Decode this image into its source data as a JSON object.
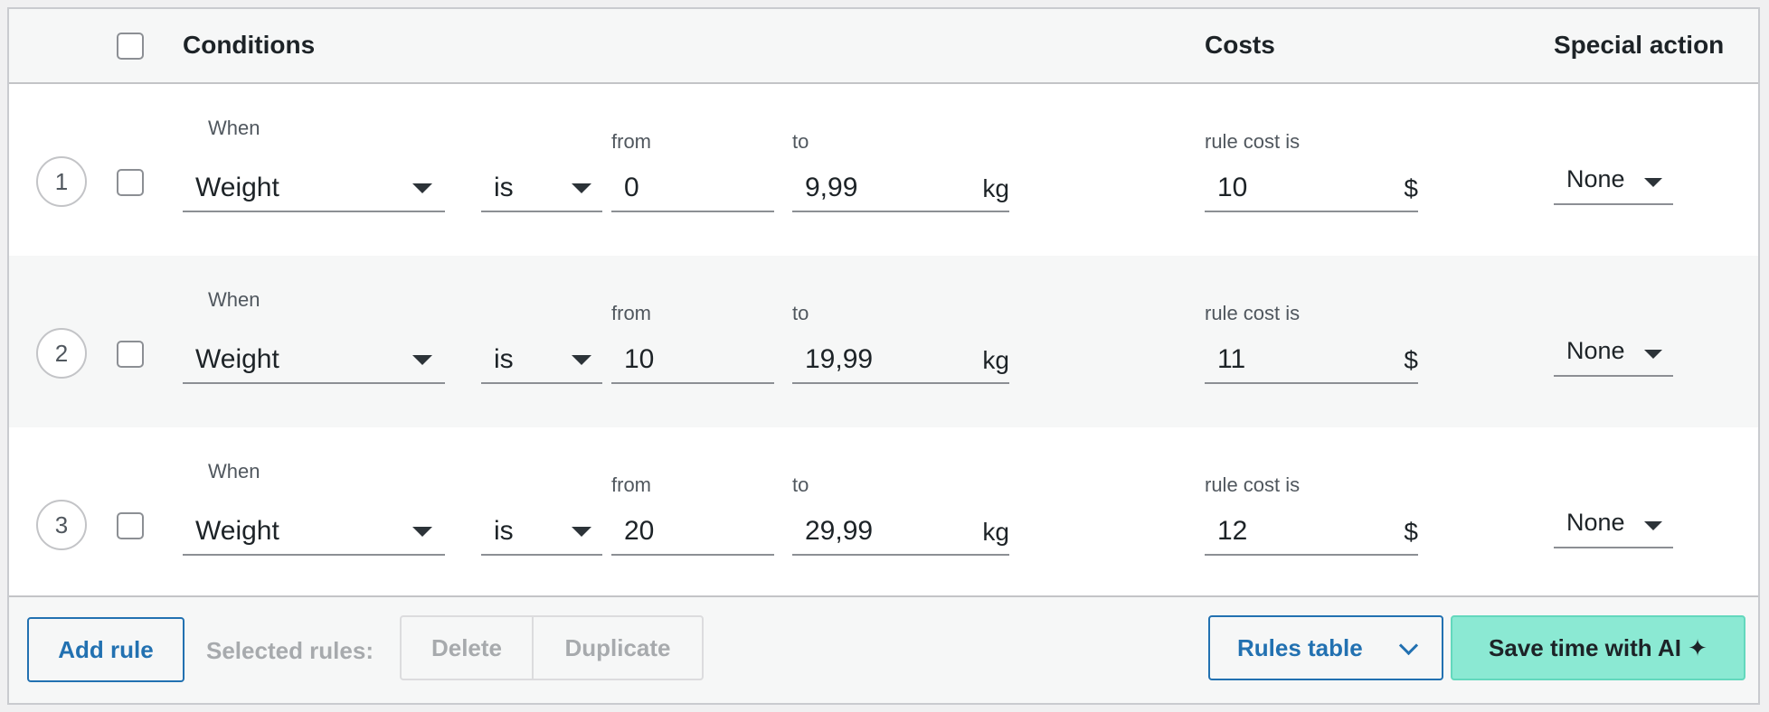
{
  "header": {
    "conditions": "Conditions",
    "costs": "Costs",
    "special_action": "Special action"
  },
  "labels": {
    "when": "When",
    "from": "from",
    "to": "to",
    "rule_cost": "rule cost is",
    "weight_unit": "kg",
    "currency": "$"
  },
  "rules": [
    {
      "number": "1",
      "condition": "Weight",
      "operator": "is",
      "from": "0",
      "to": "9,99",
      "cost": "10",
      "special": "None"
    },
    {
      "number": "2",
      "condition": "Weight",
      "operator": "is",
      "from": "10",
      "to": "19,99",
      "cost": "11",
      "special": "None"
    },
    {
      "number": "3",
      "condition": "Weight",
      "operator": "is",
      "from": "20",
      "to": "29,99",
      "cost": "12",
      "special": "None"
    }
  ],
  "footer": {
    "add_rule": "Add rule",
    "selected_rules": "Selected rules:",
    "delete": "Delete",
    "duplicate": "Duplicate",
    "rules_table": "Rules table",
    "save_ai": "Save time with AI ✦"
  },
  "colors": {
    "accent": "#2271b1",
    "ai_button": "#8be9d3",
    "disabled": "#a7aaad"
  }
}
